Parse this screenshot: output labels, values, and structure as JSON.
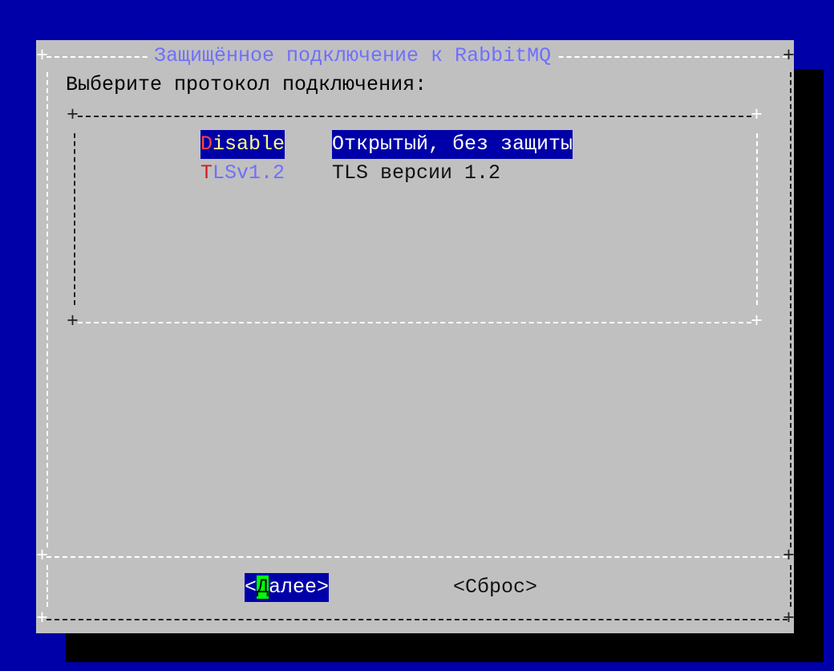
{
  "dialog": {
    "title": "Защищённое подключение к RabbitMQ",
    "prompt": "Выберите протокол подключения:"
  },
  "menu": {
    "items": [
      {
        "tag_hotkey": "D",
        "tag_rest": "isable",
        "description": "Открытый, без защиты",
        "selected": true
      },
      {
        "tag_hotkey": "T",
        "tag_rest": "LSv1.2",
        "description": "TLS версии 1.2",
        "selected": false
      }
    ]
  },
  "buttons": {
    "next": {
      "open": "<",
      "hotkey": "Д",
      "rest": "алее",
      "close": ">"
    },
    "reset": {
      "label": "<Сброс>"
    }
  },
  "frame": {
    "corner": "+",
    "vertical": "|"
  },
  "colors": {
    "background": "#0000a8",
    "dialog": "#c0c0c0",
    "title": "#6f6fff",
    "selection": "#0000a8",
    "hotkey": "#ff4040",
    "button_hotkey": "#00ff00"
  }
}
